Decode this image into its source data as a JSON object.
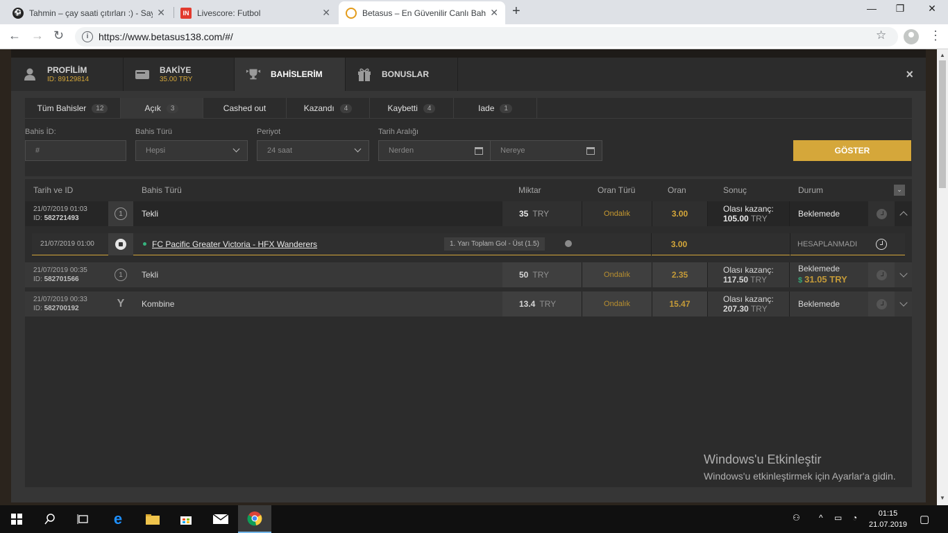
{
  "browser": {
    "tabs": [
      {
        "title": "Tahmin – çay saati çıtırları :) - Sayf",
        "active": false
      },
      {
        "title": "Livescore: Futbol",
        "active": false
      },
      {
        "title": "Betasus – En Güvenilir Canlı Bahis",
        "active": true
      }
    ],
    "url": "https://www.betasus138.com/#/"
  },
  "modal": {
    "tabs": [
      {
        "label": "PROFİLİM",
        "sub": "ID: 89129814"
      },
      {
        "label": "BAKİYE",
        "sub": "35.00 TRY"
      },
      {
        "label": "BAHİSLERİM",
        "sub": ""
      },
      {
        "label": "BONUSLAR",
        "sub": ""
      }
    ],
    "close": "×"
  },
  "filter_tabs": [
    {
      "label": "Tüm Bahisler",
      "count": "12"
    },
    {
      "label": "Açık",
      "count": "3"
    },
    {
      "label": "Cashed out",
      "count": ""
    },
    {
      "label": "Kazandı",
      "count": "4"
    },
    {
      "label": "Kaybetti",
      "count": "4"
    },
    {
      "label": "Iade",
      "count": "1"
    }
  ],
  "filters": {
    "bet_id": {
      "label": "Bahis İD:",
      "placeholder": "#"
    },
    "bet_type": {
      "label": "Bahis Türü",
      "value": "Hepsi"
    },
    "period": {
      "label": "Periyot",
      "value": "24 saat"
    },
    "date_range": {
      "label": "Tarih Aralığı",
      "from": "Nerden",
      "to": "Nereye"
    },
    "submit": "GÖSTER"
  },
  "table": {
    "headers": {
      "date_id": "Tarih ve ID",
      "bet_type": "Bahis Türü",
      "amount": "Miktar",
      "odd_type": "Oran Türü",
      "odd": "Oran",
      "result": "Sonuç",
      "status": "Durum"
    },
    "rows": [
      {
        "date": "21/07/2019 01:03",
        "id_label": "ID:",
        "id": "582721493",
        "type_icon": "1",
        "type": "Tekli",
        "amount": "35",
        "currency": "TRY",
        "odd_type": "Ondalık",
        "odd": "3.00",
        "result_label": "Olası kazanç:",
        "result_value": "105.00",
        "result_currency": "TRY",
        "status": "Beklemede",
        "cashout": ""
      },
      {
        "date": "21/07/2019 00:35",
        "id_label": "ID:",
        "id": "582701566",
        "type_icon": "1",
        "type": "Tekli",
        "amount": "50",
        "currency": "TRY",
        "odd_type": "Ondalık",
        "odd": "2.35",
        "result_label": "Olası kazanç:",
        "result_value": "117.50",
        "result_currency": "TRY",
        "status": "Beklemede",
        "cashout": "31.05 TRY"
      },
      {
        "date": "21/07/2019 00:33",
        "id_label": "ID:",
        "id": "582700192",
        "type_icon": "Y",
        "type": "Kombine",
        "amount": "13.4",
        "currency": "TRY",
        "odd_type": "Ondalık",
        "odd": "15.47",
        "result_label": "Olası kazanç:",
        "result_value": "207.30",
        "result_currency": "TRY",
        "status": "Beklemede",
        "cashout": ""
      }
    ],
    "selection": {
      "date": "21/07/2019 01:00",
      "match": "FC Pacific Greater Victoria - HFX Wanderers",
      "market": "1. Yarı Toplam Gol - Üst (1.5)",
      "odd": "3.00",
      "status": "HESAPLANMADI"
    }
  },
  "watermark": {
    "title": "Windows'u Etkinleştir",
    "subtitle": "Windows'u etkinleştirmek için Ayarlar'a gidin."
  },
  "taskbar": {
    "time": "01:15",
    "date": "21.07.2019"
  }
}
